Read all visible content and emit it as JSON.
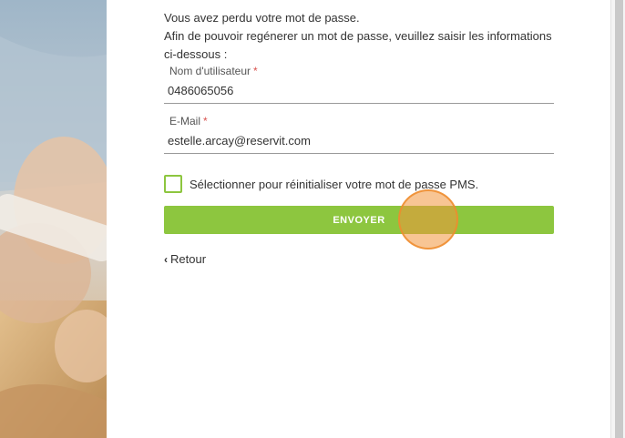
{
  "intro": {
    "line1": "Vous avez perdu votre mot de passe.",
    "line2": "Afin de pouvoir regénerer un mot de passe, veuillez saisir les informations ci-dessous :"
  },
  "form": {
    "username": {
      "label": "Nom d'utilisateur",
      "required_mark": "*",
      "value": "0486065056"
    },
    "email": {
      "label": "E-Mail",
      "required_mark": "*",
      "value": "estelle.arcay@reservit.com"
    },
    "pms_checkbox": {
      "label": "Sélectionner pour réinitialiser votre mot de passe PMS.",
      "checked": false
    },
    "submit_label": "ENVOYER",
    "back_label": "Retour",
    "back_icon": "chevron-left-icon"
  },
  "colors": {
    "accent": "#8dc63f",
    "required": "#d9534f",
    "click_marker": "#f3963c"
  }
}
